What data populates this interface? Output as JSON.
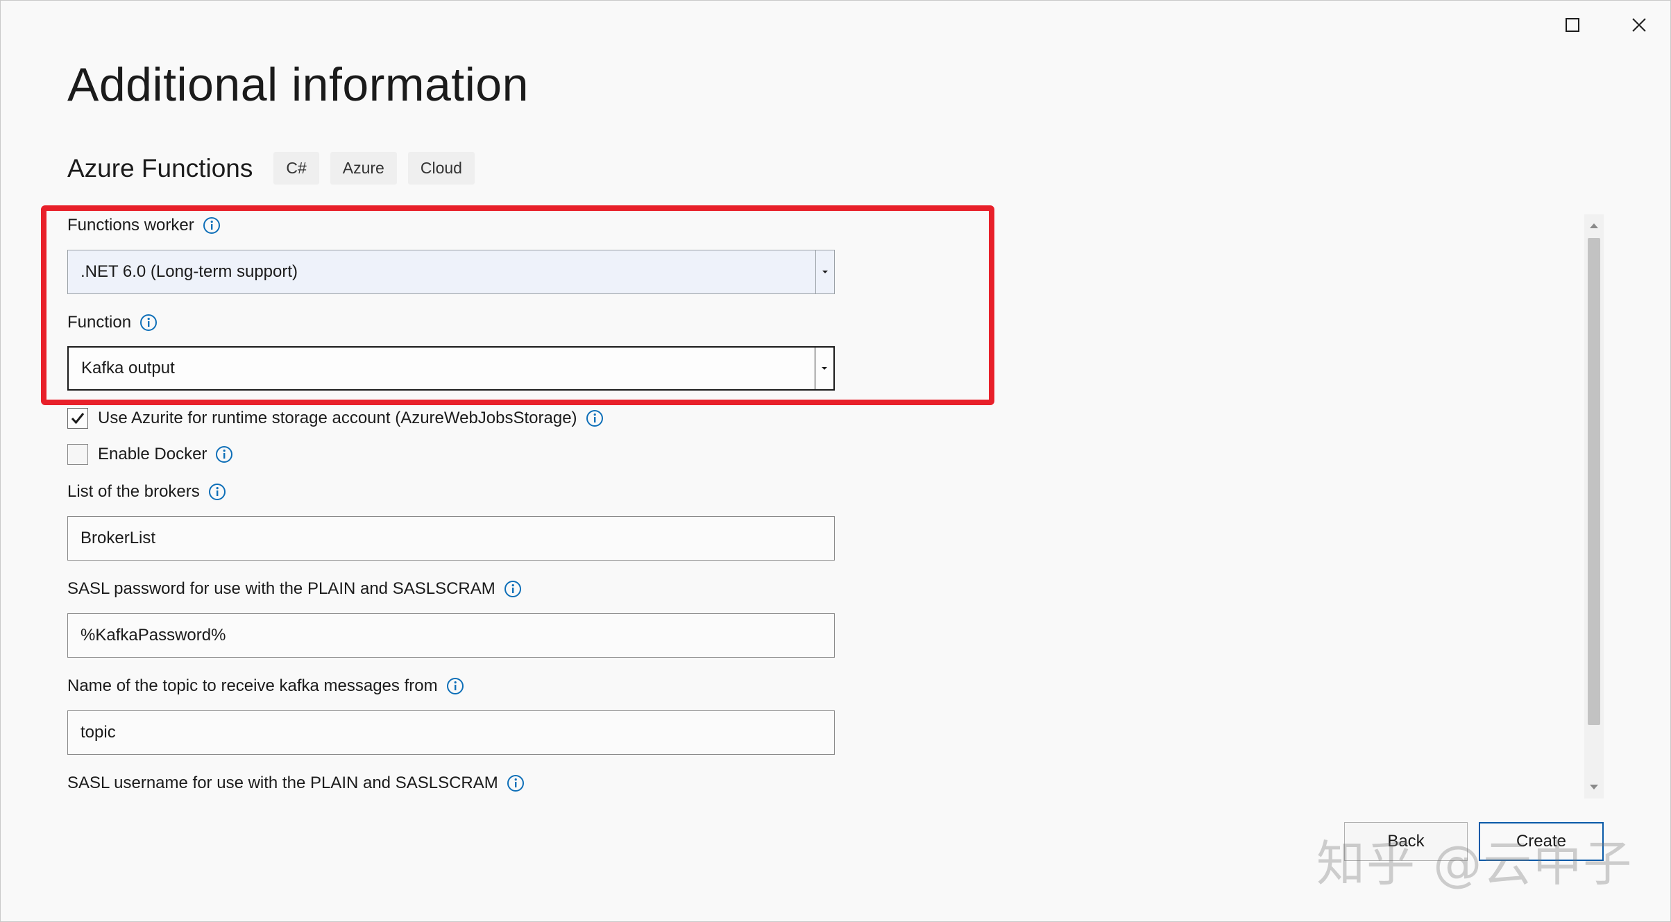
{
  "window": {
    "maximize_icon": "maximize-icon",
    "close_icon": "close-icon"
  },
  "header": {
    "title": "Additional information",
    "template_name": "Azure Functions",
    "tags": [
      "C#",
      "Azure",
      "Cloud"
    ]
  },
  "form": {
    "functions_worker": {
      "label": "Functions worker",
      "value": ".NET 6.0 (Long-term support)"
    },
    "function": {
      "label": "Function",
      "value": "Kafka output"
    },
    "use_azurite": {
      "label": "Use Azurite for runtime storage account (AzureWebJobsStorage)",
      "checked": true
    },
    "enable_docker": {
      "label": "Enable Docker",
      "checked": false
    },
    "brokers": {
      "label": "List of the brokers",
      "value": "BrokerList"
    },
    "sasl_password": {
      "label": "SASL password for use with the PLAIN and SASLSCRAM",
      "value": "%KafkaPassword%"
    },
    "topic": {
      "label": "Name of the topic to receive kafka messages from",
      "value": "topic"
    },
    "sasl_username": {
      "label": "SASL username for use with the PLAIN and SASLSCRAM"
    }
  },
  "footer": {
    "back_label": "Back",
    "create_label": "Create"
  },
  "watermark": "知乎 @云中子",
  "colors": {
    "accent": "#0a5aa8",
    "info_icon": "#0e6fb8",
    "highlight": "#e8202a"
  }
}
